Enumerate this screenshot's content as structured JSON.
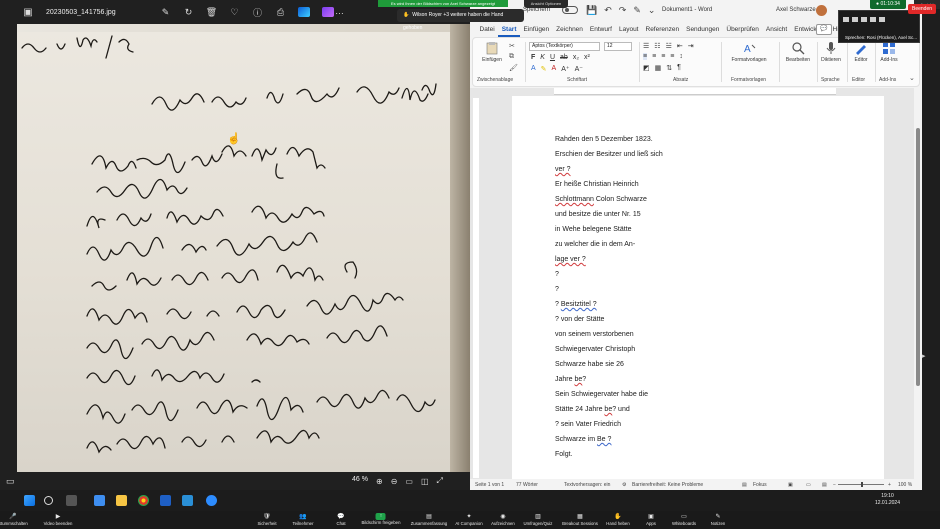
{
  "viewer": {
    "filename": "20230503_141756.jpg",
    "zoom": "46 %"
  },
  "zoom_overlay": {
    "share_banner": "Es wird Ihnen der Bildschirm von Axel Schwarze angezeigt",
    "view_options": "Ansicht Optionen",
    "hand_banner": "Wilson Royer +3 weitere haben die Hand gehoben",
    "timer": "01:10:34",
    "view_button": "Ansicht",
    "speaker_name": "Sprechen: Rosi (Flücken), Axel Sc..."
  },
  "word": {
    "autosave_label": "Speichern",
    "doc_title": "Dokument1 - Word",
    "user_name": "Axel Schwarze",
    "tabs": [
      "Datei",
      "Start",
      "Einfügen",
      "Zeichnen",
      "Entwurf",
      "Layout",
      "Referenzen",
      "Sendungen",
      "Überprüfen",
      "Ansicht",
      "Entwicklert",
      "Hilfe"
    ],
    "active_tab": "Start",
    "ribbon": {
      "paste": "Einfügen",
      "clipboard_group": "Zwischenablage",
      "font_name": "Aptos (Textkörper)",
      "font_size": "12",
      "font_group": "Schriftart",
      "paragraph_group": "Absatz",
      "styles_button": "Formatvorlagen",
      "styles_group": "Formatvorlagen",
      "edit_button": "Bearbeiten",
      "dictate_button": "Diktieren",
      "speech_group": "Sprache",
      "editor_button": "Editor",
      "editor_group": "Editor",
      "addins_button": "Add-Ins",
      "addins_group": "Add-Ins"
    },
    "document_lines": [
      {
        "parts": [
          {
            "t": "Rahden den 5 Dezember 1823."
          }
        ]
      },
      {
        "parts": [
          {
            "t": "Erschien der Besitzer und ließ sich"
          }
        ]
      },
      {
        "parts": [
          {
            "t": "ver ?",
            "s": "red"
          }
        ]
      },
      {
        "parts": [
          {
            "t": "Er heiße Christian Heinrich"
          }
        ]
      },
      {
        "parts": [
          {
            "t": "Schlottmann",
            "s": "red"
          },
          {
            "t": " Colon Schwarze"
          }
        ]
      },
      {
        "parts": [
          {
            "t": "und besitze die unter Nr. 15"
          }
        ]
      },
      {
        "parts": [
          {
            "t": "in Wehe belegene Stätte"
          }
        ]
      },
      {
        "parts": [
          {
            "t": "zu welcher die in dem An-"
          }
        ]
      },
      {
        "parts": [
          {
            "t": "lage ver ?",
            "s": "red"
          }
        ]
      },
      {
        "parts": [
          {
            "t": "?"
          }
        ]
      },
      {
        "parts": [
          {
            "t": "?"
          }
        ]
      },
      {
        "parts": [
          {
            "t": "? "
          },
          {
            "t": "Besitztitel ?",
            "s": "blue"
          }
        ]
      },
      {
        "parts": [
          {
            "t": "? von der Stätte"
          }
        ]
      },
      {
        "parts": [
          {
            "t": "von seinem verstorbenen"
          }
        ]
      },
      {
        "parts": [
          {
            "t": "Schwiegervater Christoph"
          }
        ]
      },
      {
        "parts": [
          {
            "t": "Schwarze habe sie 26"
          }
        ]
      },
      {
        "parts": [
          {
            "t": "Jahre "
          },
          {
            "t": "be",
            "s": "red"
          },
          {
            "t": "?"
          }
        ]
      },
      {
        "parts": [
          {
            "t": "Sein Schwiegervater habe die"
          }
        ]
      },
      {
        "parts": [
          {
            "t": "Stätte 24 Jahre "
          },
          {
            "t": "be",
            "s": "red"
          },
          {
            "t": "? und"
          }
        ]
      },
      {
        "parts": [
          {
            "t": "? sein Vater Friedrich"
          }
        ]
      },
      {
        "parts": [
          {
            "t": "Schwarze im "
          },
          {
            "t": "Be ?",
            "s": "blue"
          }
        ]
      },
      {
        "parts": [
          {
            "t": "Folgt."
          }
        ]
      }
    ],
    "status": {
      "page": "Seite 1 von 1",
      "words": "77 Wörter",
      "predictions": "Textvorhersagen: ein",
      "accessibility": "Barrierefreiheit: Keine Probleme",
      "focus": "Fokus",
      "zoom": "100 %"
    }
  },
  "taskbar": {
    "time": "19:10",
    "date": "12.01.2024"
  },
  "zoom_toolbar": {
    "items": [
      {
        "id": "mute",
        "label": "Stummschalten",
        "icon": "microphone-icon"
      },
      {
        "id": "video",
        "label": "Video beenden",
        "icon": "camera-icon"
      },
      {
        "id": "security",
        "label": "Sicherheit",
        "icon": "shield-icon"
      },
      {
        "id": "participants",
        "label": "Teilnehmer",
        "icon": "people-icon"
      },
      {
        "id": "chat",
        "label": "Chat",
        "icon": "chat-icon"
      },
      {
        "id": "share",
        "label": "Bildschirm freigeben",
        "icon": "share-screen-icon"
      },
      {
        "id": "summary",
        "label": "Zusammenfassung",
        "icon": "summary-icon"
      },
      {
        "id": "companion",
        "label": "AI Companion",
        "icon": "sparkle-icon"
      },
      {
        "id": "record",
        "label": "Aufzeichnen",
        "icon": "record-icon"
      },
      {
        "id": "polls",
        "label": "Umfragen/Quiz",
        "icon": "poll-icon"
      },
      {
        "id": "breakout",
        "label": "Breakout Sessions",
        "icon": "grid-icon"
      },
      {
        "id": "raise",
        "label": "Hand heben",
        "icon": "hand-icon"
      },
      {
        "id": "apps",
        "label": "Apps",
        "icon": "apps-icon"
      },
      {
        "id": "whiteboards",
        "label": "Whiteboards",
        "icon": "whiteboard-icon"
      },
      {
        "id": "notes",
        "label": "Notizen",
        "icon": "notes-icon"
      }
    ],
    "end_label": "Beenden"
  }
}
